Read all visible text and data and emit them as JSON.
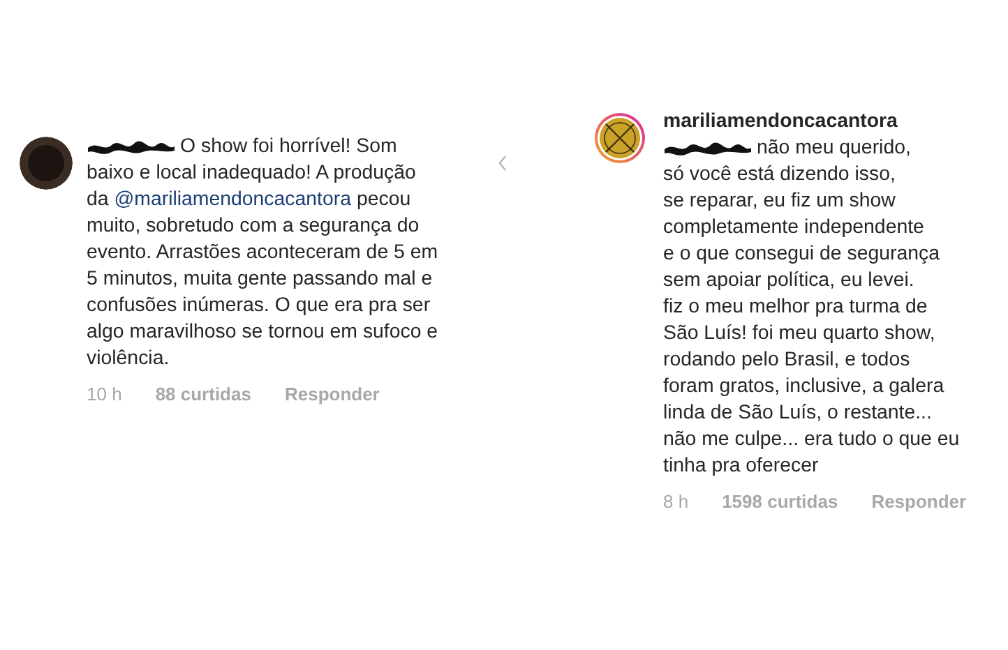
{
  "comments": [
    {
      "story_ring": false,
      "lines": [
        [
          {
            "kind": "redacted"
          },
          {
            "kind": "text",
            "text": "O show foi horrível! Som"
          }
        ],
        [
          {
            "kind": "text",
            "text": "baixo e local inadequado! A produção"
          }
        ],
        [
          {
            "kind": "text",
            "text": "da "
          },
          {
            "kind": "mention",
            "text": "@mariliamendoncacantora"
          },
          {
            "kind": "text",
            "text": " pecou"
          }
        ],
        [
          {
            "kind": "text",
            "text": "muito, sobretudo com a segurança do"
          }
        ],
        [
          {
            "kind": "text",
            "text": "evento. Arrastões aconteceram de 5 em"
          }
        ],
        [
          {
            "kind": "text",
            "text": "5 minutos, muita gente passando mal e"
          }
        ],
        [
          {
            "kind": "text",
            "text": "confusões inúmeras. O que era pra ser"
          }
        ],
        [
          {
            "kind": "text",
            "text": "algo maravilhoso se tornou em sufoco e"
          }
        ],
        [
          {
            "kind": "text",
            "text": "violência."
          }
        ]
      ],
      "time": "10 h",
      "likes": "88 curtidas",
      "reply": "Responder"
    },
    {
      "story_ring": true,
      "author": "mariliamendoncacantora",
      "lines": [
        [
          {
            "kind": "redacted"
          },
          {
            "kind": "text",
            "text": "não meu querido,"
          }
        ],
        [
          {
            "kind": "text",
            "text": "só você está dizendo isso,"
          }
        ],
        [
          {
            "kind": "text",
            "text": "se reparar, eu fiz um show"
          }
        ],
        [
          {
            "kind": "text",
            "text": "completamente independente"
          }
        ],
        [
          {
            "kind": "text",
            "text": "e o que consegui de segurança"
          }
        ],
        [
          {
            "kind": "text",
            "text": "sem apoiar política, eu levei."
          }
        ],
        [
          {
            "kind": "text",
            "text": "fiz o meu melhor pra turma de"
          }
        ],
        [
          {
            "kind": "text",
            "text": "São Luís! foi meu quarto show,"
          }
        ],
        [
          {
            "kind": "text",
            "text": "rodando pelo Brasil, e todos"
          }
        ],
        [
          {
            "kind": "text",
            "text": "foram gratos, inclusive, a galera"
          }
        ],
        [
          {
            "kind": "text",
            "text": "linda de São Luís, o restante..."
          }
        ],
        [
          {
            "kind": "text",
            "text": "não me culpe... era tudo o que eu"
          }
        ],
        [
          {
            "kind": "text",
            "text": "tinha pra oferecer"
          }
        ]
      ],
      "time": "8 h",
      "likes": "1598 curtidas",
      "reply": "Responder"
    }
  ]
}
